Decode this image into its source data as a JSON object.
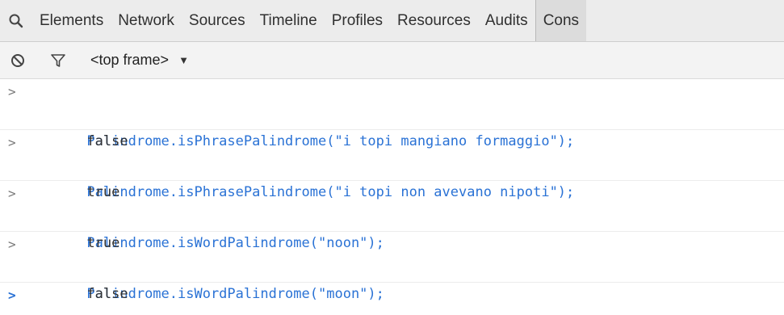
{
  "tabs": [
    {
      "label": "Elements"
    },
    {
      "label": "Network"
    },
    {
      "label": "Sources"
    },
    {
      "label": "Timeline"
    },
    {
      "label": "Profiles"
    },
    {
      "label": "Resources"
    },
    {
      "label": "Audits"
    },
    {
      "label": "Cons"
    }
  ],
  "subbar": {
    "frame_label": "<top frame>"
  },
  "console": {
    "prompt_symbol": ">",
    "entries": [
      {
        "command": "Palindrome.isPhrasePalindrome(\"i topi mangiano formaggio\");",
        "result": "false"
      },
      {
        "command": "Palindrome.isPhrasePalindrome(\"i topi non avevano nipoti\");",
        "result": "true"
      },
      {
        "command": "Palindrome.isWordPalindrome(\"noon\");",
        "result": "true"
      },
      {
        "command": "Palindrome.isWordPalindrome(\"moon\");",
        "result": "false"
      }
    ]
  },
  "colors": {
    "command": "#2a72d5",
    "result": "#303030",
    "toolbar_bg": "#ececec"
  },
  "icons": [
    "search-icon",
    "clear-console-icon",
    "filter-icon",
    "dropdown-arrow-icon",
    "prompt-icon"
  ]
}
